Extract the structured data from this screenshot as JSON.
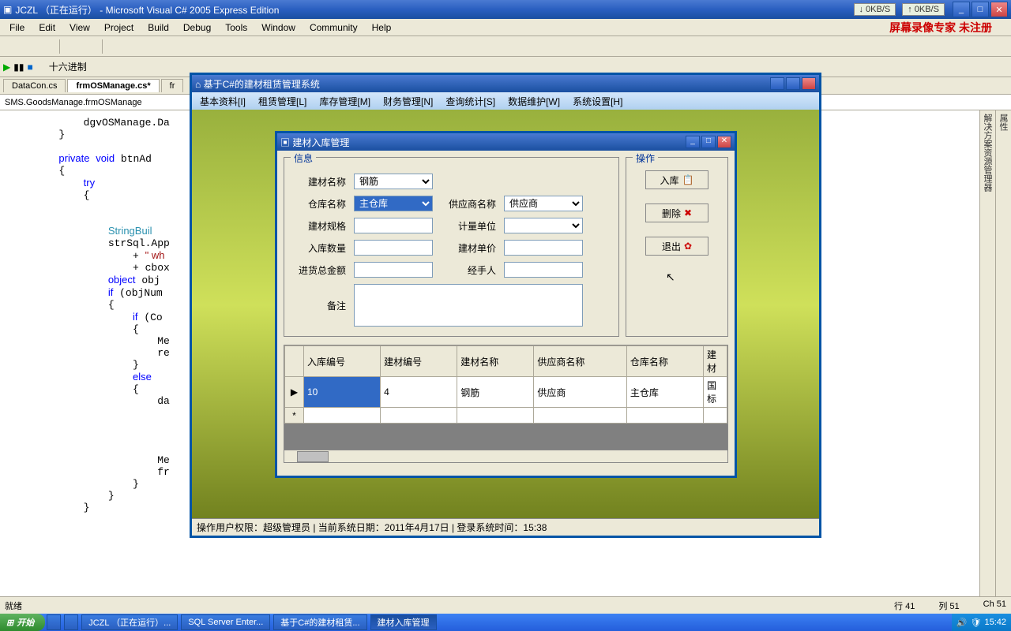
{
  "vs": {
    "title": "JCZL （正在运行） - Microsoft Visual C# 2005 Express Edition",
    "net_down": "↓   0KB/S",
    "net_up": "↑   0KB/S",
    "menus": [
      "File",
      "Edit",
      "View",
      "Project",
      "Build",
      "Debug",
      "Tools",
      "Window",
      "Community",
      "Help"
    ],
    "watermark": "屏幕录像专家 未注册",
    "toolbar2_label": "十六进制",
    "tabs": [
      "DataCon.cs",
      "frmOSManage.cs*",
      "fr"
    ],
    "crumb": "SMS.GoodsManage.frmOSManage",
    "status_left": "就绪",
    "status_line": "行 41",
    "status_col": "列 51",
    "status_ch": "Ch 51",
    "right_tray1": "解决方案资源管理器",
    "right_tray2": "属性",
    "code_lines": [
      "            dgvOSManage.Da",
      "        }",
      "",
      "        private void btnAd",
      "        {",
      "            try",
      "            {",
      "",
      "",
      "                StringBuil",
      "                strSql.App",
      "                    + \" wh",
      "                    + cbox",
      "                object obj",
      "                if (objNum",
      "                {",
      "                    if (Co",
      "                    {",
      "                        Me",
      "                        re",
      "                    }",
      "                    else",
      "                    {",
      "                        da",
      "",
      "",
      "",
      "",
      "                        Me",
      "                        fr",
      "                    }",
      "                }",
      "            }"
    ]
  },
  "app": {
    "title": "基于C#的建材租赁管理系统",
    "menus": [
      "基本资料[I]",
      "租赁管理[L]",
      "库存管理[M]",
      "财务管理[N]",
      "查询统计[S]",
      "数据维护[W]",
      "系统设置[H]"
    ],
    "status": "操作用户权限：超级管理员 | 当前系统日期：2011年4月17日 | 登录系统时间：15:38"
  },
  "dlg": {
    "title": "建材入库管理",
    "gb_info": "信息",
    "gb_ops": "操作",
    "labels": {
      "material_name": "建材名称",
      "warehouse_name": "仓库名称",
      "supplier_name": "供应商名称",
      "spec": "建材规格",
      "unit": "计量单位",
      "qty": "入库数量",
      "price": "建材单价",
      "total": "进货总金额",
      "handler": "经手人",
      "remark": "备注"
    },
    "values": {
      "material_name": "钢筋",
      "warehouse_name": "主仓库",
      "supplier_name": "供应商",
      "spec": "",
      "unit": "",
      "qty": "",
      "price": "",
      "total": "",
      "handler": "",
      "remark": ""
    },
    "buttons": {
      "in": "入库",
      "del": "删除",
      "exit": "退出"
    },
    "grid": {
      "headers": [
        "入库编号",
        "建材编号",
        "建材名称",
        "供应商名称",
        "仓库名称",
        "建材"
      ],
      "rows": [
        {
          "id": "10",
          "matno": "4",
          "matname": "钢筋",
          "supplier": "供应商",
          "warehouse": "主仓库",
          "ext": "国标"
        }
      ]
    }
  },
  "taskbar": {
    "start": "开始",
    "items": [
      "JCZL （正在运行）...",
      "SQL Server Enter...",
      "基于C#的建材租赁...",
      "建材入库管理"
    ],
    "clock": "15:42"
  }
}
